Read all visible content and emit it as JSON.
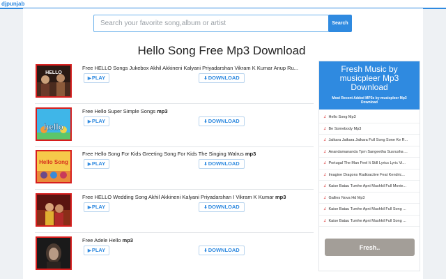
{
  "site_name": "djpunjab",
  "search": {
    "placeholder": "Search your favorite song,album or artist",
    "button_label": "Search"
  },
  "page_title": "Hello Song Free Mp3 Download",
  "songs": [
    {
      "title": "Free HELLO Songs Jukebox Akhil Akkineni Kalyani Priyadarshan Vikram K Kumar Anup Ru...",
      "suffix": "",
      "play_label": "PLAY",
      "download_label": "DOWNLOAD",
      "thumb_text": "HELLO"
    },
    {
      "title": "Free Hello Super Simple Songs ",
      "suffix": "mp3",
      "play_label": "PLAY",
      "download_label": "DOWNLOAD",
      "thumb_text": "hello"
    },
    {
      "title": "Free Hello Song For Kids Greeting Song For Kids The Singing Walrus ",
      "suffix": "mp3",
      "play_label": "PLAY",
      "download_label": "DOWNLOAD",
      "thumb_text": "Hello Song"
    },
    {
      "title": "Free HELLO Wedding Song Akhil Akkineni Kalyani Priyadarshan I Vikram K Kumar ",
      "suffix": "mp3",
      "play_label": "PLAY",
      "download_label": "DOWNLOAD",
      "thumb_text": ""
    },
    {
      "title": "Free Adele Hello ",
      "suffix": "mp3",
      "play_label": "PLAY",
      "download_label": "DOWNLOAD",
      "thumb_text": ""
    }
  ],
  "sidebar": {
    "title": "Fresh Music by musicpleer Mp3 Download",
    "subtitle": "Most Recent Added MP3s by musicpleer Mp3 Download",
    "items": [
      "Hello Song Mp3",
      "Be Somebody Mp3",
      "Jaikara Jaikara Jaikara Full Song Sone Ke R...",
      "Anandamananda Tpm Sangeetha Susrusha ...",
      "Portugal The Man Feel It Still Lyrics Lyric Vi...",
      "Imagine Dragons Radioactive Feat Kendric...",
      "Kaise Batau Tumhe Apni Mushkil Full Movie...",
      "Gallies Nova Hd Mp3",
      "Kaise Batau Tumhe Apni Mushkil Full Song ...",
      "Kaise Batau Tumhe Apni Mushkil Full Song ..."
    ],
    "fresh_button_label": "Fresh.."
  },
  "icons": {
    "play": "play-icon",
    "download": "download-icon",
    "note": "music-note-icon"
  },
  "colors": {
    "accent": "#2f8ae0",
    "thumb_border": "#d71e1e",
    "fresh_button": "#a39e98"
  }
}
